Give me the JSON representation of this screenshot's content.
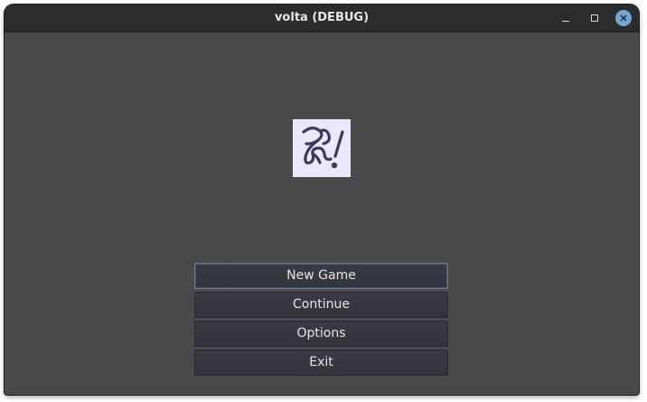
{
  "window": {
    "title": "volta (DEBUG)",
    "controls": {
      "minimize_icon": "minimize-icon",
      "maximize_icon": "maximize-icon",
      "close_icon": "close-icon"
    }
  },
  "logo": {
    "icon": "app-logo-icon",
    "background": "#e9e8fd",
    "glyph_color": "#3b3a5c"
  },
  "menu": {
    "buttons": [
      {
        "label": "New Game",
        "focused": true
      },
      {
        "label": "Continue",
        "focused": false
      },
      {
        "label": "Options",
        "focused": false
      },
      {
        "label": "Exit",
        "focused": false
      }
    ]
  },
  "colors": {
    "background": "#4a4a4a",
    "titlebar": "#2c2c2c",
    "close_button": "#74a6cf",
    "button_bg": "#37373f",
    "focus_border": "#6a7d97"
  }
}
